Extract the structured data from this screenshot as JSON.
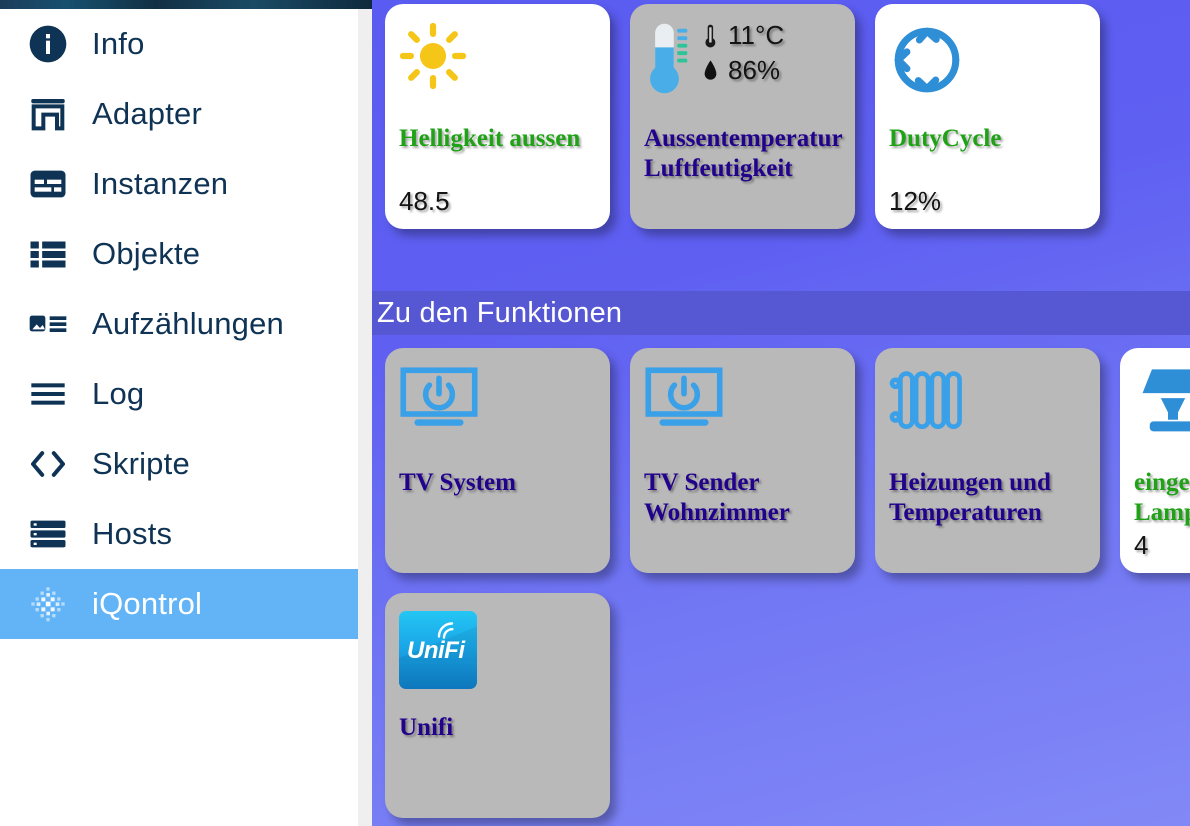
{
  "sidebar": {
    "items": [
      {
        "label": "Info",
        "icon": "info-icon",
        "active": false
      },
      {
        "label": "Adapter",
        "icon": "store-icon",
        "active": false
      },
      {
        "label": "Instanzen",
        "icon": "instances-icon",
        "active": false
      },
      {
        "label": "Objekte",
        "icon": "list-icon",
        "active": false
      },
      {
        "label": "Aufzählungen",
        "icon": "enum-icon",
        "active": false
      },
      {
        "label": "Log",
        "icon": "lines-icon",
        "active": false
      },
      {
        "label": "Skripte",
        "icon": "code-icon",
        "active": false
      },
      {
        "label": "Hosts",
        "icon": "server-icon",
        "active": false
      },
      {
        "label": "iQontrol",
        "icon": "iqontrol-icon",
        "active": true
      }
    ]
  },
  "stage": {
    "status_tiles": [
      {
        "title": "Helligkeit aussen",
        "title_color": "#1fa215",
        "value": "48.5",
        "icon": "sun-icon",
        "background": "#ffffff"
      },
      {
        "title_line1": "Aussentemperatur",
        "title_line2": "Luftfeutigkeit",
        "title_color": "#22018c",
        "temperature": "11°C",
        "humidity": "86%",
        "icon": "thermometer-icon",
        "temperature_icon": "thermometer-glyph",
        "humidity_icon": "droplet-glyph",
        "background": "#b9b9b9"
      },
      {
        "title": "DutyCycle",
        "title_color": "#1fa215",
        "value": "12%",
        "icon": "refresh-cycle-icon",
        "background": "#ffffff"
      }
    ],
    "section_header": "Zu den Funktionen",
    "function_tiles": [
      {
        "title_line1": "TV System",
        "title_line2": "",
        "title_color": "#22018c",
        "value": "",
        "icon": "tv-power-icon",
        "background": "#b9b9b9"
      },
      {
        "title_line1": "TV Sender",
        "title_line2": "Wohnzimmer",
        "title_color": "#22018c",
        "value": "",
        "icon": "tv-power-icon",
        "background": "#b9b9b9"
      },
      {
        "title_line1": "Heizungen und",
        "title_line2": "Temperaturen",
        "title_color": "#22018c",
        "value": "",
        "icon": "radiator-icon",
        "background": "#b9b9b9"
      },
      {
        "title_line1": "eingeschaltete",
        "title_line2": "Lampen",
        "title_color": "#1fa215",
        "value": "4",
        "icon": "lamp-icon",
        "background": "#ffffff"
      }
    ],
    "function_tiles_row2": [
      {
        "title_line1": "Unifi",
        "title_line2": "",
        "title_color": "#22018c",
        "value": "",
        "icon": "unifi-logo-icon",
        "logo_text": "UniFi",
        "background": "#b9b9b9"
      }
    ]
  },
  "colors": {
    "sidebar_active": "#62b4f7",
    "sidebar_text": "#0f3354",
    "stage_gradient_start": "#5a5bf0",
    "stage_gradient_end": "#8289f6",
    "section_band": "#5557d3",
    "tile_grey": "#b9b9b9",
    "title_green": "#1fa215",
    "title_navy": "#22018c",
    "icon_blue": "#2f8fd6",
    "sun_yellow": "#f5c518"
  }
}
